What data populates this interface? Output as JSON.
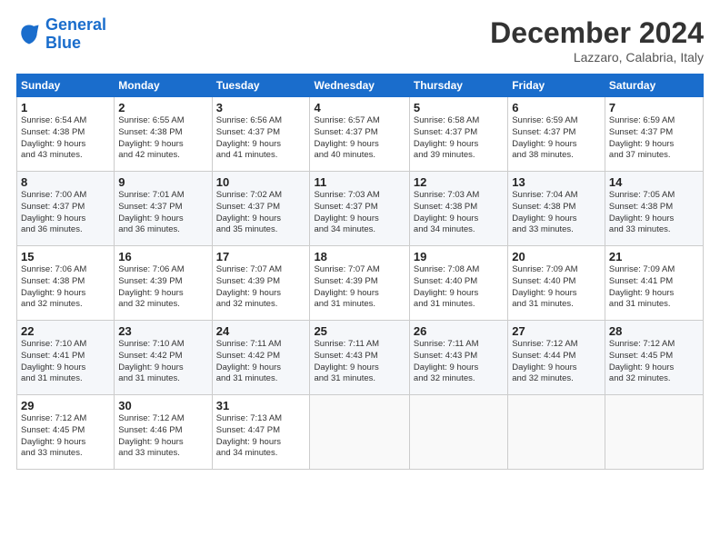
{
  "logo": {
    "line1": "General",
    "line2": "Blue"
  },
  "title": "December 2024",
  "location": "Lazzaro, Calabria, Italy",
  "headers": [
    "Sunday",
    "Monday",
    "Tuesday",
    "Wednesday",
    "Thursday",
    "Friday",
    "Saturday"
  ],
  "weeks": [
    [
      {
        "day": "1",
        "info": "Sunrise: 6:54 AM\nSunset: 4:38 PM\nDaylight: 9 hours\nand 43 minutes."
      },
      {
        "day": "2",
        "info": "Sunrise: 6:55 AM\nSunset: 4:38 PM\nDaylight: 9 hours\nand 42 minutes."
      },
      {
        "day": "3",
        "info": "Sunrise: 6:56 AM\nSunset: 4:37 PM\nDaylight: 9 hours\nand 41 minutes."
      },
      {
        "day": "4",
        "info": "Sunrise: 6:57 AM\nSunset: 4:37 PM\nDaylight: 9 hours\nand 40 minutes."
      },
      {
        "day": "5",
        "info": "Sunrise: 6:58 AM\nSunset: 4:37 PM\nDaylight: 9 hours\nand 39 minutes."
      },
      {
        "day": "6",
        "info": "Sunrise: 6:59 AM\nSunset: 4:37 PM\nDaylight: 9 hours\nand 38 minutes."
      },
      {
        "day": "7",
        "info": "Sunrise: 6:59 AM\nSunset: 4:37 PM\nDaylight: 9 hours\nand 37 minutes."
      }
    ],
    [
      {
        "day": "8",
        "info": "Sunrise: 7:00 AM\nSunset: 4:37 PM\nDaylight: 9 hours\nand 36 minutes."
      },
      {
        "day": "9",
        "info": "Sunrise: 7:01 AM\nSunset: 4:37 PM\nDaylight: 9 hours\nand 36 minutes."
      },
      {
        "day": "10",
        "info": "Sunrise: 7:02 AM\nSunset: 4:37 PM\nDaylight: 9 hours\nand 35 minutes."
      },
      {
        "day": "11",
        "info": "Sunrise: 7:03 AM\nSunset: 4:37 PM\nDaylight: 9 hours\nand 34 minutes."
      },
      {
        "day": "12",
        "info": "Sunrise: 7:03 AM\nSunset: 4:38 PM\nDaylight: 9 hours\nand 34 minutes."
      },
      {
        "day": "13",
        "info": "Sunrise: 7:04 AM\nSunset: 4:38 PM\nDaylight: 9 hours\nand 33 minutes."
      },
      {
        "day": "14",
        "info": "Sunrise: 7:05 AM\nSunset: 4:38 PM\nDaylight: 9 hours\nand 33 minutes."
      }
    ],
    [
      {
        "day": "15",
        "info": "Sunrise: 7:06 AM\nSunset: 4:38 PM\nDaylight: 9 hours\nand 32 minutes."
      },
      {
        "day": "16",
        "info": "Sunrise: 7:06 AM\nSunset: 4:39 PM\nDaylight: 9 hours\nand 32 minutes."
      },
      {
        "day": "17",
        "info": "Sunrise: 7:07 AM\nSunset: 4:39 PM\nDaylight: 9 hours\nand 32 minutes."
      },
      {
        "day": "18",
        "info": "Sunrise: 7:07 AM\nSunset: 4:39 PM\nDaylight: 9 hours\nand 31 minutes."
      },
      {
        "day": "19",
        "info": "Sunrise: 7:08 AM\nSunset: 4:40 PM\nDaylight: 9 hours\nand 31 minutes."
      },
      {
        "day": "20",
        "info": "Sunrise: 7:09 AM\nSunset: 4:40 PM\nDaylight: 9 hours\nand 31 minutes."
      },
      {
        "day": "21",
        "info": "Sunrise: 7:09 AM\nSunset: 4:41 PM\nDaylight: 9 hours\nand 31 minutes."
      }
    ],
    [
      {
        "day": "22",
        "info": "Sunrise: 7:10 AM\nSunset: 4:41 PM\nDaylight: 9 hours\nand 31 minutes."
      },
      {
        "day": "23",
        "info": "Sunrise: 7:10 AM\nSunset: 4:42 PM\nDaylight: 9 hours\nand 31 minutes."
      },
      {
        "day": "24",
        "info": "Sunrise: 7:11 AM\nSunset: 4:42 PM\nDaylight: 9 hours\nand 31 minutes."
      },
      {
        "day": "25",
        "info": "Sunrise: 7:11 AM\nSunset: 4:43 PM\nDaylight: 9 hours\nand 31 minutes."
      },
      {
        "day": "26",
        "info": "Sunrise: 7:11 AM\nSunset: 4:43 PM\nDaylight: 9 hours\nand 32 minutes."
      },
      {
        "day": "27",
        "info": "Sunrise: 7:12 AM\nSunset: 4:44 PM\nDaylight: 9 hours\nand 32 minutes."
      },
      {
        "day": "28",
        "info": "Sunrise: 7:12 AM\nSunset: 4:45 PM\nDaylight: 9 hours\nand 32 minutes."
      }
    ],
    [
      {
        "day": "29",
        "info": "Sunrise: 7:12 AM\nSunset: 4:45 PM\nDaylight: 9 hours\nand 33 minutes."
      },
      {
        "day": "30",
        "info": "Sunrise: 7:12 AM\nSunset: 4:46 PM\nDaylight: 9 hours\nand 33 minutes."
      },
      {
        "day": "31",
        "info": "Sunrise: 7:13 AM\nSunset: 4:47 PM\nDaylight: 9 hours\nand 34 minutes."
      },
      {
        "day": "",
        "info": ""
      },
      {
        "day": "",
        "info": ""
      },
      {
        "day": "",
        "info": ""
      },
      {
        "day": "",
        "info": ""
      }
    ]
  ]
}
